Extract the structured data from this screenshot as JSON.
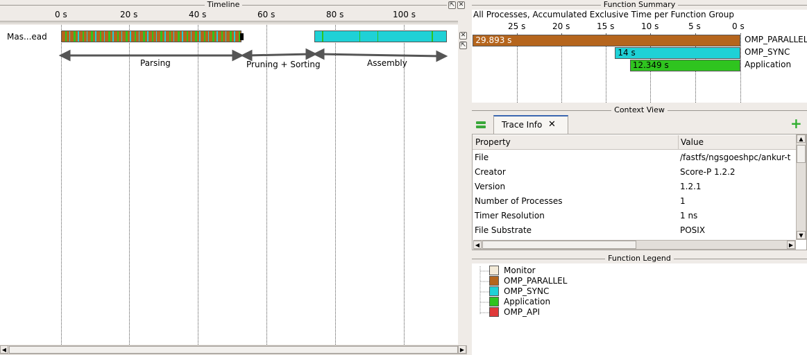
{
  "timeline": {
    "title": "Timeline",
    "ticks": [
      "0 s",
      "20 s",
      "40 s",
      "60 s",
      "80 s",
      "100 s"
    ],
    "process_label": "Mas...ead",
    "phases": [
      "Parsing",
      "Pruning + Sorting",
      "Assembly"
    ]
  },
  "function_summary": {
    "title": "Function Summary",
    "subtitle": "All Processes, Accumulated Exclusive Time per Function Group",
    "ticks": [
      "25 s",
      "20 s",
      "15 s",
      "10 s",
      "5 s",
      "0 s"
    ],
    "rows": [
      {
        "name": "OMP_PARALLEL",
        "value_label": "29.893 s",
        "value": 29.893,
        "color": "#b5651d"
      },
      {
        "name": "OMP_SYNC",
        "value_label": "14 s",
        "value": 14,
        "color": "#1fd1d6"
      },
      {
        "name": "Application",
        "value_label": "12.349 s",
        "value": 12.349,
        "color": "#2fc41f"
      }
    ]
  },
  "context_view": {
    "title": "Context View",
    "tab_label": "Trace Info",
    "columns": [
      "Property",
      "Value"
    ],
    "rows": [
      {
        "property": "File",
        "value": "/fastfs/ngsgoeshpc/ankur-t"
      },
      {
        "property": "Creator",
        "value": "Score-P 1.2.2"
      },
      {
        "property": "Version",
        "value": "1.2.1"
      },
      {
        "property": "Number of Processes",
        "value": "1"
      },
      {
        "property": "Timer Resolution",
        "value": "1 ns"
      },
      {
        "property": "File Substrate",
        "value": "POSIX"
      }
    ]
  },
  "function_legend": {
    "title": "Function Legend",
    "items": [
      {
        "name": "Monitor",
        "color": "#f3ead8"
      },
      {
        "name": "OMP_PARALLEL",
        "color": "#b5651d"
      },
      {
        "name": "OMP_SYNC",
        "color": "#1fd1d6"
      },
      {
        "name": "Application",
        "color": "#2fc41f"
      },
      {
        "name": "OMP_API",
        "color": "#e03a3a"
      }
    ]
  }
}
